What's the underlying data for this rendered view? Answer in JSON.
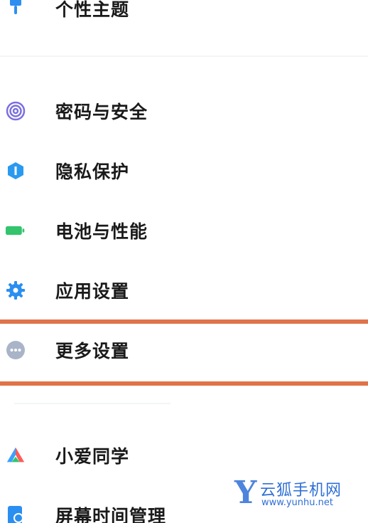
{
  "settings": {
    "items": [
      {
        "label": "个性主题",
        "icon": "theme-brush-icon",
        "color": "#2f8ff0"
      },
      {
        "label": "密码与安全",
        "icon": "fingerprint-icon",
        "color": "#7b6fe0"
      },
      {
        "label": "隐私保护",
        "icon": "privacy-shield-icon",
        "color": "#2a9af0"
      },
      {
        "label": "电池与性能",
        "icon": "battery-icon",
        "color": "#33c46d"
      },
      {
        "label": "应用设置",
        "icon": "gear-icon",
        "color": "#2a8ff0"
      },
      {
        "label": "更多设置",
        "icon": "more-dots-icon",
        "color": "#a9b4c8"
      },
      {
        "label": "小爱同学",
        "icon": "xiaoai-icon",
        "color": "#ff5a5a"
      },
      {
        "label": "屏幕时间管理",
        "icon": "screen-time-icon",
        "color": "#2a8ff0"
      }
    ]
  },
  "highlight": {
    "color": "#e0734a"
  },
  "watermark": {
    "letter": "Y",
    "name": "云狐手机网",
    "url": "www.yunhu.net",
    "color": "#2f6fd6"
  }
}
